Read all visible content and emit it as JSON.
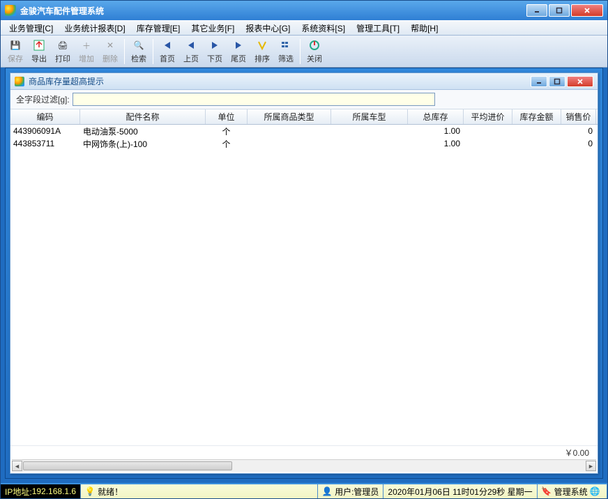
{
  "window": {
    "title": "金骏汽车配件管理系统"
  },
  "menu": {
    "items": [
      "业务管理[C]",
      "业务统计报表[D]",
      "库存管理[E]",
      "其它业务[F]",
      "报表中心[G]",
      "系统资料[S]",
      "管理工具[T]",
      "帮助[H]"
    ]
  },
  "toolbar": {
    "save": "保存",
    "export": "导出",
    "print": "打印",
    "add": "增加",
    "del": "删除",
    "search": "检索",
    "first": "首页",
    "prev": "上页",
    "next": "下页",
    "last": "尾页",
    "sort": "排序",
    "filter": "筛选",
    "close": "关闭"
  },
  "inner": {
    "title": "商品库存量超高提示",
    "filter_label": "全字段过滤[g]:",
    "filter_value": ""
  },
  "grid": {
    "headers": {
      "code": "编码",
      "name": "配件名称",
      "unit": "单位",
      "cat": "所属商品类型",
      "model": "所属车型",
      "stock": "总库存",
      "avg": "平均进价",
      "amt": "库存金额",
      "price": "销售价"
    },
    "rows": [
      {
        "code": "443906091A",
        "name": "电动油泵-5000",
        "unit": "个",
        "cat": "",
        "model": "",
        "stock": "1.00",
        "avg": "",
        "amt": "",
        "price": "0"
      },
      {
        "code": "443853711",
        "name": "中网饰条(上)-100",
        "unit": "个",
        "cat": "",
        "model": "",
        "stock": "1.00",
        "avg": "",
        "amt": "",
        "price": "0"
      }
    ],
    "total": "￥0.00"
  },
  "status": {
    "ip_label": "IP地址: ",
    "ip": "192.168.1.6",
    "ready": "就绪！",
    "user_label": "用户:",
    "user": "管理员",
    "datetime": "2020年01月06日 11时01分29秒 星期一",
    "sys": "管理系统"
  }
}
